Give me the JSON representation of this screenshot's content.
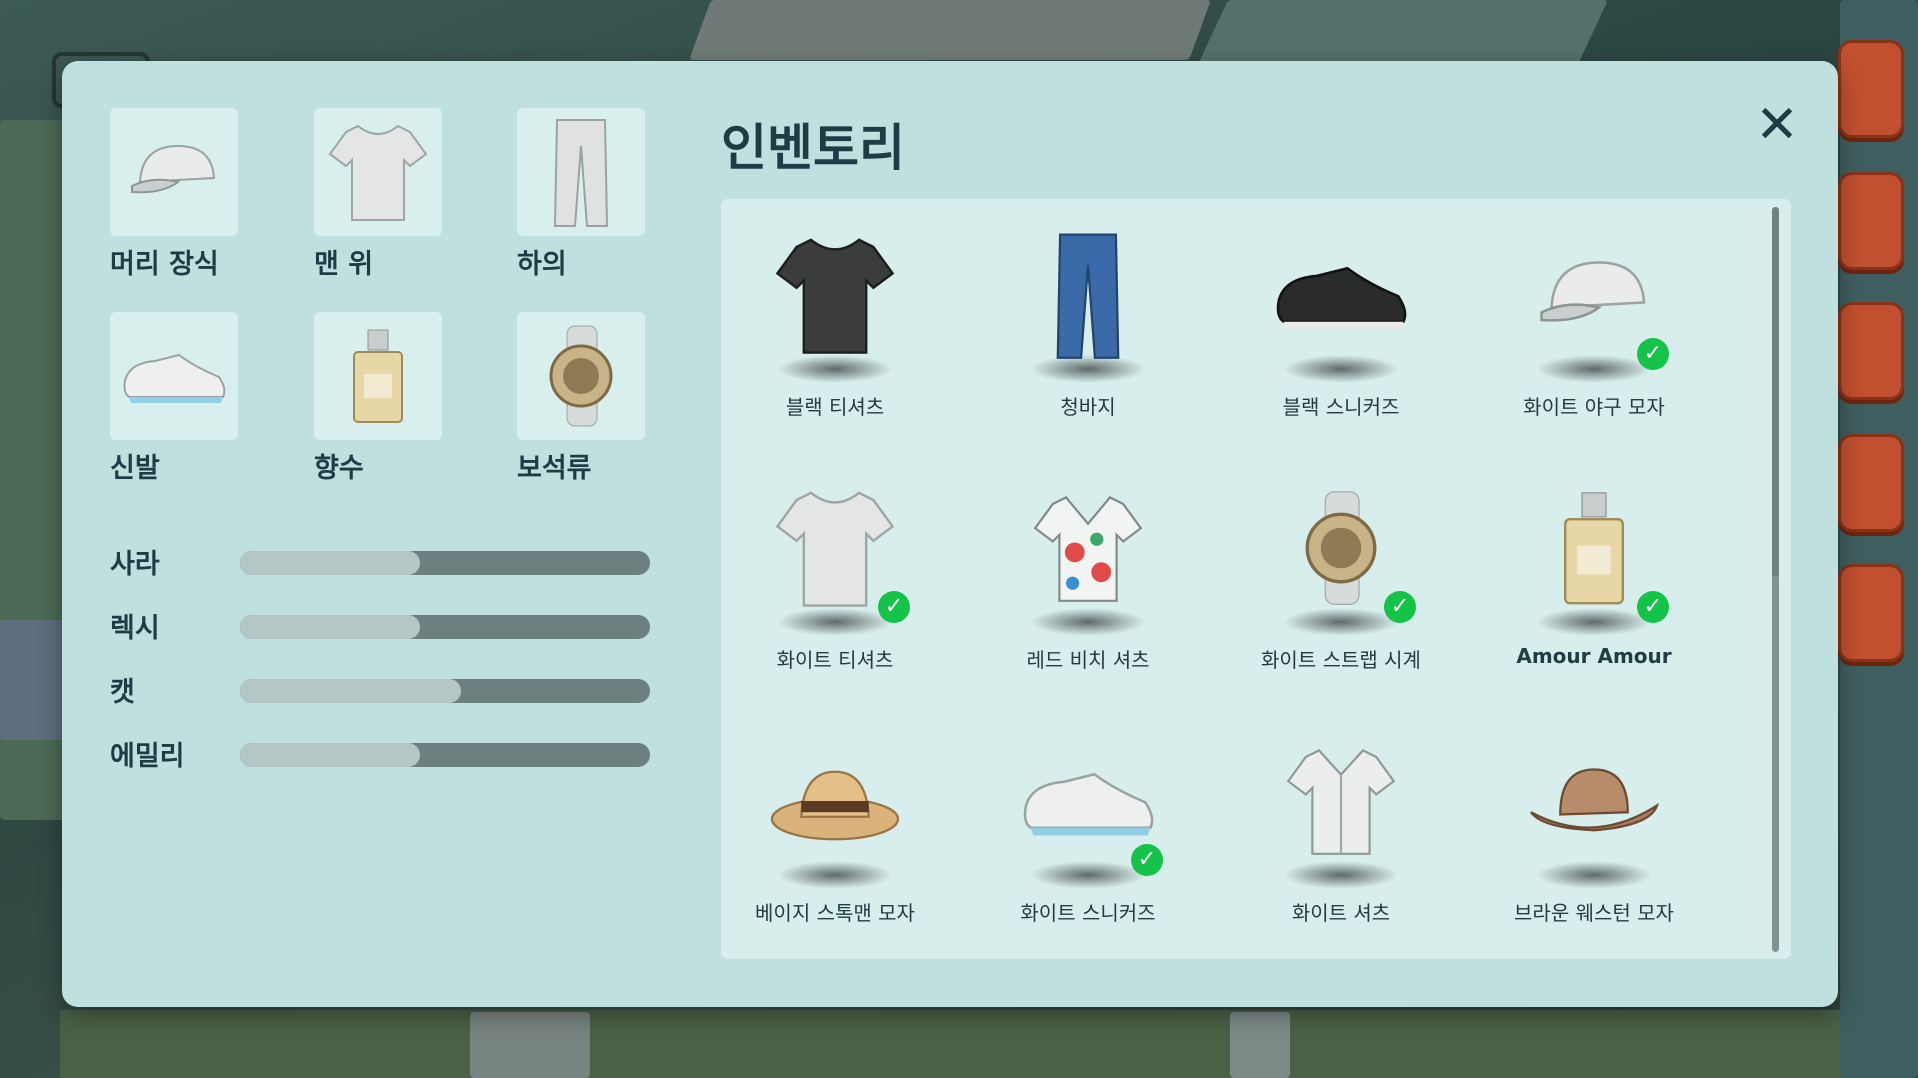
{
  "inventory": {
    "title": "인벤토리"
  },
  "categories": [
    {
      "label": "머리 장식",
      "icon": "cap-icon"
    },
    {
      "label": "맨 위",
      "icon": "tshirt-icon"
    },
    {
      "label": "하의",
      "icon": "pants-icon"
    },
    {
      "label": "신발",
      "icon": "sneaker-icon"
    },
    {
      "label": "향수",
      "icon": "perfume-icon"
    },
    {
      "label": "보석류",
      "icon": "watch-icon"
    }
  ],
  "relationships": [
    {
      "name": "사라",
      "level": 0.44
    },
    {
      "name": "렉시",
      "level": 0.44
    },
    {
      "name": "캣",
      "level": 0.54
    },
    {
      "name": "에밀리",
      "level": 0.44
    }
  ],
  "items": [
    {
      "name": "블랙 티셔츠",
      "icon": "black-tshirt-icon",
      "equipped": false
    },
    {
      "name": "청바지",
      "icon": "jeans-icon",
      "equipped": false
    },
    {
      "name": "블랙 스니커즈",
      "icon": "black-sneaker-icon",
      "equipped": false
    },
    {
      "name": "화이트 야구 모자",
      "icon": "white-cap-icon",
      "equipped": true
    },
    {
      "name": "화이트 티셔츠",
      "icon": "white-tshirt-icon",
      "equipped": true
    },
    {
      "name": "레드 비치 셔츠",
      "icon": "hawaiian-shirt-icon",
      "equipped": false
    },
    {
      "name": "화이트 스트랩 시계",
      "icon": "watch-icon",
      "equipped": true
    },
    {
      "name": "Amour Amour",
      "icon": "perfume-icon",
      "equipped": true
    },
    {
      "name": "베이지 스톡맨 모자",
      "icon": "beige-hat-icon",
      "equipped": false
    },
    {
      "name": "화이트 스니커즈",
      "icon": "white-sneaker-icon",
      "equipped": true
    },
    {
      "name": "화이트 셔츠",
      "icon": "white-shirt-icon",
      "equipped": false
    },
    {
      "name": "브라운 웨스턴 모자",
      "icon": "brown-hat-icon",
      "equipped": false
    }
  ],
  "colors": {
    "equipped_check": "#14c348",
    "panel": "#bfe0df",
    "text": "#1f3c46"
  }
}
